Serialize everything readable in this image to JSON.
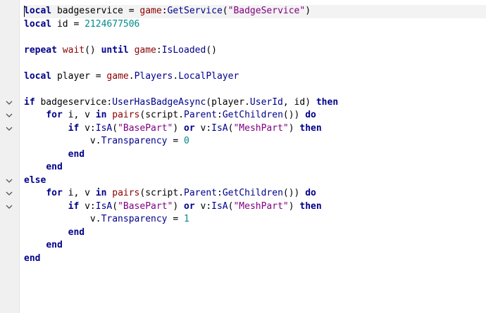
{
  "lines": [
    [
      {
        "t": "local",
        "c": "k"
      },
      {
        "t": " badgeservice ",
        "c": "p"
      },
      {
        "t": "=",
        "c": "o"
      },
      {
        "t": " ",
        "c": "p"
      },
      {
        "t": "game",
        "c": "g"
      },
      {
        "t": ":",
        "c": "p"
      },
      {
        "t": "GetService",
        "c": "f"
      },
      {
        "t": "(",
        "c": "p"
      },
      {
        "t": "\"BadgeService\"",
        "c": "s"
      },
      {
        "t": ")",
        "c": "p"
      }
    ],
    [
      {
        "t": "local",
        "c": "k"
      },
      {
        "t": " id ",
        "c": "p"
      },
      {
        "t": "=",
        "c": "o"
      },
      {
        "t": " ",
        "c": "p"
      },
      {
        "t": "2124677506",
        "c": "n"
      }
    ],
    [],
    [
      {
        "t": "repeat",
        "c": "k"
      },
      {
        "t": " ",
        "c": "p"
      },
      {
        "t": "wait",
        "c": "g"
      },
      {
        "t": "() ",
        "c": "p"
      },
      {
        "t": "until",
        "c": "k"
      },
      {
        "t": " ",
        "c": "p"
      },
      {
        "t": "game",
        "c": "g"
      },
      {
        "t": ":",
        "c": "p"
      },
      {
        "t": "IsLoaded",
        "c": "f"
      },
      {
        "t": "()",
        "c": "p"
      }
    ],
    [],
    [
      {
        "t": "local",
        "c": "k"
      },
      {
        "t": " player ",
        "c": "p"
      },
      {
        "t": "=",
        "c": "o"
      },
      {
        "t": " ",
        "c": "p"
      },
      {
        "t": "game",
        "c": "g"
      },
      {
        "t": ".",
        "c": "p"
      },
      {
        "t": "Players",
        "c": "f"
      },
      {
        "t": ".",
        "c": "p"
      },
      {
        "t": "LocalPlayer",
        "c": "f"
      }
    ],
    [],
    [
      {
        "t": "if",
        "c": "k"
      },
      {
        "t": " badgeservice:",
        "c": "p"
      },
      {
        "t": "UserHasBadgeAsync",
        "c": "f"
      },
      {
        "t": "(player.",
        "c": "p"
      },
      {
        "t": "UserId",
        "c": "f"
      },
      {
        "t": ", id) ",
        "c": "p"
      },
      {
        "t": "then",
        "c": "k"
      }
    ],
    [
      {
        "t": "    ",
        "c": "p"
      },
      {
        "t": "for",
        "c": "k"
      },
      {
        "t": " i, v ",
        "c": "p"
      },
      {
        "t": "in",
        "c": "k"
      },
      {
        "t": " ",
        "c": "p"
      },
      {
        "t": "pairs",
        "c": "g"
      },
      {
        "t": "(script.",
        "c": "p"
      },
      {
        "t": "Parent",
        "c": "f"
      },
      {
        "t": ":",
        "c": "p"
      },
      {
        "t": "GetChildren",
        "c": "f"
      },
      {
        "t": "()) ",
        "c": "p"
      },
      {
        "t": "do",
        "c": "k"
      }
    ],
    [
      {
        "t": "        ",
        "c": "p"
      },
      {
        "t": "if",
        "c": "k"
      },
      {
        "t": " v:",
        "c": "p"
      },
      {
        "t": "IsA",
        "c": "f"
      },
      {
        "t": "(",
        "c": "p"
      },
      {
        "t": "\"BasePart\"",
        "c": "s"
      },
      {
        "t": ") ",
        "c": "p"
      },
      {
        "t": "or",
        "c": "k"
      },
      {
        "t": " v:",
        "c": "p"
      },
      {
        "t": "IsA",
        "c": "f"
      },
      {
        "t": "(",
        "c": "p"
      },
      {
        "t": "\"MeshPart\"",
        "c": "s"
      },
      {
        "t": ") ",
        "c": "p"
      },
      {
        "t": "then",
        "c": "k"
      }
    ],
    [
      {
        "t": "            v.",
        "c": "p"
      },
      {
        "t": "Transparency",
        "c": "f"
      },
      {
        "t": " ",
        "c": "p"
      },
      {
        "t": "=",
        "c": "o"
      },
      {
        "t": " ",
        "c": "p"
      },
      {
        "t": "0",
        "c": "n"
      }
    ],
    [
      {
        "t": "        ",
        "c": "p"
      },
      {
        "t": "end",
        "c": "k"
      }
    ],
    [
      {
        "t": "    ",
        "c": "p"
      },
      {
        "t": "end",
        "c": "k"
      }
    ],
    [
      {
        "t": "else",
        "c": "k"
      }
    ],
    [
      {
        "t": "    ",
        "c": "p"
      },
      {
        "t": "for",
        "c": "k"
      },
      {
        "t": " i, v ",
        "c": "p"
      },
      {
        "t": "in",
        "c": "k"
      },
      {
        "t": " ",
        "c": "p"
      },
      {
        "t": "pairs",
        "c": "g"
      },
      {
        "t": "(script.",
        "c": "p"
      },
      {
        "t": "Parent",
        "c": "f"
      },
      {
        "t": ":",
        "c": "p"
      },
      {
        "t": "GetChildren",
        "c": "f"
      },
      {
        "t": "()) ",
        "c": "p"
      },
      {
        "t": "do",
        "c": "k"
      }
    ],
    [
      {
        "t": "        ",
        "c": "p"
      },
      {
        "t": "if",
        "c": "k"
      },
      {
        "t": " v:",
        "c": "p"
      },
      {
        "t": "IsA",
        "c": "f"
      },
      {
        "t": "(",
        "c": "p"
      },
      {
        "t": "\"BasePart\"",
        "c": "s"
      },
      {
        "t": ") ",
        "c": "p"
      },
      {
        "t": "or",
        "c": "k"
      },
      {
        "t": " v:",
        "c": "p"
      },
      {
        "t": "IsA",
        "c": "f"
      },
      {
        "t": "(",
        "c": "p"
      },
      {
        "t": "\"MeshPart\"",
        "c": "s"
      },
      {
        "t": ") ",
        "c": "p"
      },
      {
        "t": "then",
        "c": "k"
      }
    ],
    [
      {
        "t": "            v.",
        "c": "p"
      },
      {
        "t": "Transparency",
        "c": "f"
      },
      {
        "t": " ",
        "c": "p"
      },
      {
        "t": "=",
        "c": "o"
      },
      {
        "t": " ",
        "c": "p"
      },
      {
        "t": "1",
        "c": "n"
      }
    ],
    [
      {
        "t": "        ",
        "c": "p"
      },
      {
        "t": "end",
        "c": "k"
      }
    ],
    [
      {
        "t": "    ",
        "c": "p"
      },
      {
        "t": "end",
        "c": "k"
      }
    ],
    [
      {
        "t": "end",
        "c": "k"
      }
    ]
  ],
  "fold_markers": [
    7,
    8,
    9,
    13,
    14,
    15
  ],
  "icons": {
    "fold": "chevron-down-icon"
  },
  "colors": {
    "keyword": "#00008b",
    "builtin": "#8b0000",
    "string": "#800080",
    "number": "#008b8b",
    "method": "#00008b"
  }
}
